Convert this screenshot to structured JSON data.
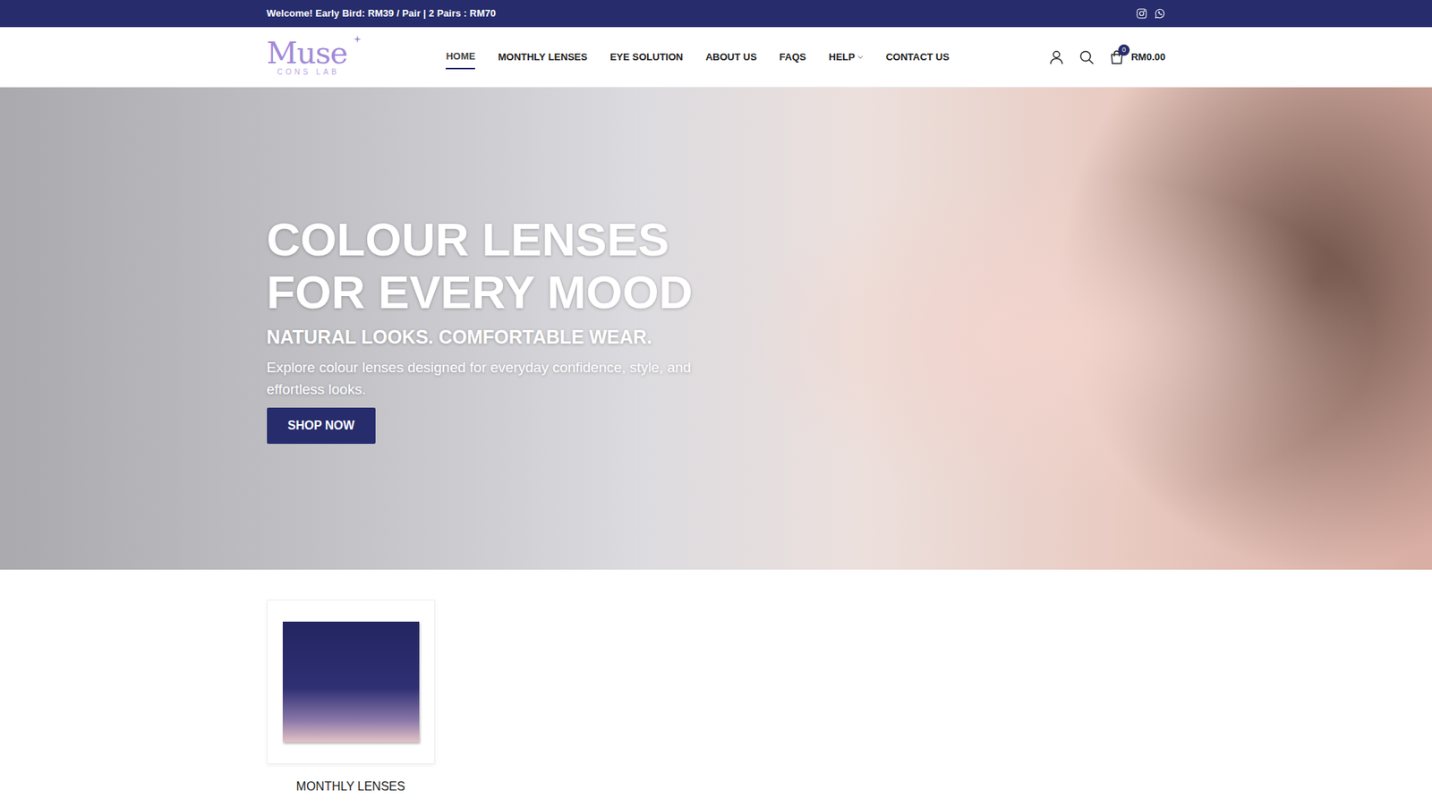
{
  "announcement": {
    "text": "Welcome! Early Bird: RM39 / Pair | 2 Pairs : RM70"
  },
  "logo": {
    "name": "Muse",
    "tagline": "CONS LAB"
  },
  "nav": [
    {
      "label": "HOME",
      "selected": true,
      "kind": "link"
    },
    {
      "label": "MONTHLY LENSES",
      "selected": false,
      "kind": "link"
    },
    {
      "label": "EYE SOLUTION",
      "selected": false,
      "kind": "link"
    },
    {
      "label": "ABOUT US",
      "selected": false,
      "kind": "link"
    },
    {
      "label": "FAQS",
      "selected": false,
      "kind": "link"
    },
    {
      "label": "HELP",
      "selected": false,
      "kind": "dropdown"
    },
    {
      "label": "CONTACT US",
      "selected": false,
      "kind": "link"
    }
  ],
  "cart": {
    "count": "0",
    "total": "RM0.00"
  },
  "hero": {
    "title": "COLOUR LENSES FOR EVERY MOOD",
    "subtitle": "NATURAL LOOKS. COMFORTABLE WEAR.",
    "text": "Explore colour lenses designed for everyday confidence, style, and effortless looks.",
    "button": "SHOP NOW"
  },
  "categories": [
    {
      "label": "MONTHLY LENSES"
    }
  ]
}
